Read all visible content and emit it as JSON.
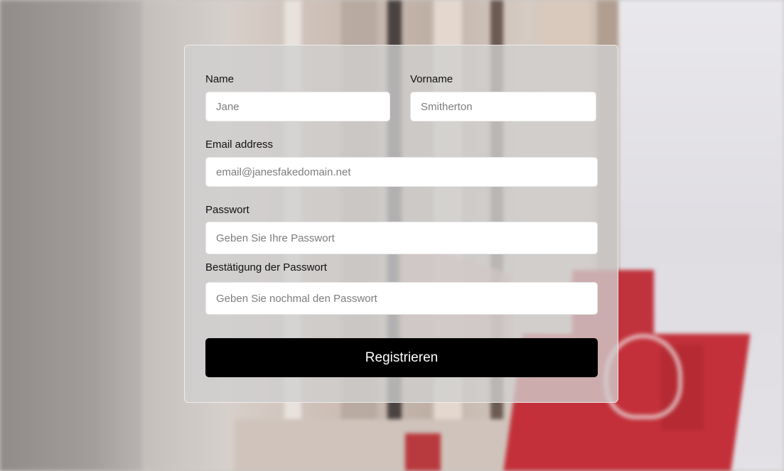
{
  "form": {
    "name": {
      "label": "Name",
      "placeholder": "Jane"
    },
    "vorname": {
      "label": "Vorname",
      "placeholder": "Smitherton"
    },
    "email": {
      "label": "Email address",
      "placeholder": "email@janesfakedomain.net"
    },
    "password": {
      "label": "Passwort",
      "placeholder": "Geben Sie Ihre Passwort"
    },
    "password_confirm": {
      "label": "Bestätigung der Passwort",
      "placeholder": "Geben Sie nochmal den Passwort"
    },
    "submit_label": "Registrieren"
  }
}
